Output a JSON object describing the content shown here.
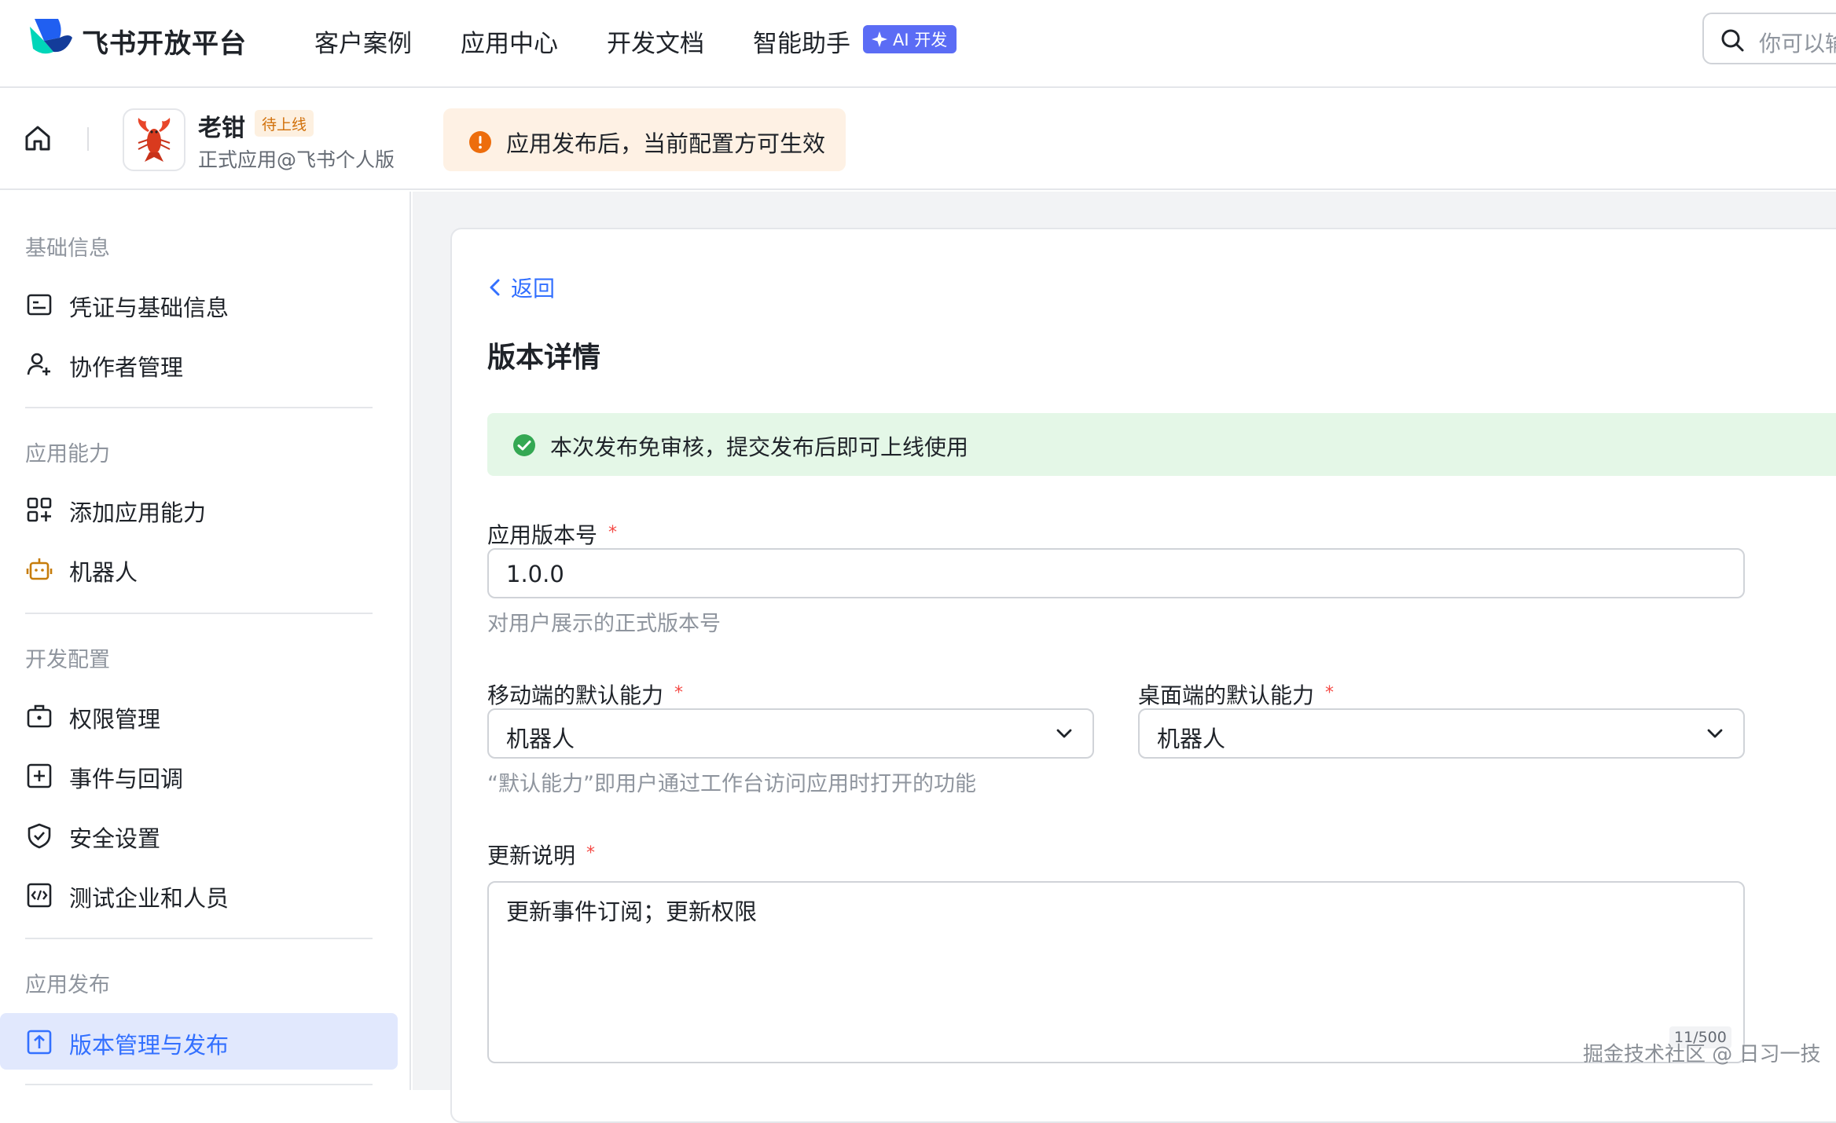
{
  "topnav": {
    "brand": "飞书开放平台",
    "items": [
      "客户案例",
      "应用中心",
      "开发文档",
      "智能助手"
    ],
    "ai_badge": "AI 开发",
    "search_placeholder": "你可以输"
  },
  "app": {
    "name": "老钳",
    "status": "待上线",
    "type": "正式应用@飞书个人版",
    "notice": "应用发布后，当前配置方可生效"
  },
  "sidebar": {
    "sections": [
      {
        "title": "基础信息",
        "items": [
          "凭证与基础信息",
          "协作者管理"
        ]
      },
      {
        "title": "应用能力",
        "items": [
          "添加应用能力",
          "机器人"
        ]
      },
      {
        "title": "开发配置",
        "items": [
          "权限管理",
          "事件与回调",
          "安全设置",
          "测试企业和人员"
        ]
      },
      {
        "title": "应用发布",
        "items": [
          "版本管理与发布"
        ]
      }
    ],
    "active_item": "版本管理与发布"
  },
  "main": {
    "back": "返回",
    "title": "版本详情",
    "success_msg": "本次发布免审核，提交发布后即可上线使用",
    "version_label": "应用版本号",
    "version_value": "1.0.0",
    "version_hint": "对用户展示的正式版本号",
    "mobile_label": "移动端的默认能力",
    "mobile_value": "机器人",
    "desktop_label": "桌面端的默认能力",
    "desktop_value": "机器人",
    "default_hint": "“默认能力”即用户通过工作台访问应用时打开的功能",
    "notes_label": "更新说明",
    "notes_value": "更新事件订阅；更新权限",
    "notes_counter": "11/500",
    "required_mark": "*"
  },
  "watermark": "掘金技术社区 @ 日习一技",
  "colors": {
    "accent": "#3370ff",
    "success": "#34a853",
    "warning": "#ed6d0c",
    "required": "#f54a45"
  }
}
